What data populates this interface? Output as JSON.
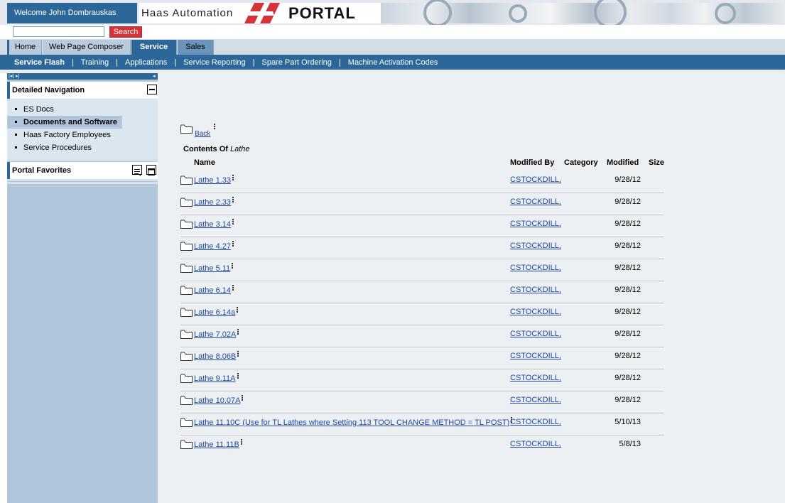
{
  "header": {
    "welcome": "Welcome John Dombrauskas",
    "brand": "Haas Automation",
    "portal": "PORTAL"
  },
  "search": {
    "value": "",
    "placeholder": "",
    "button_label": "Search"
  },
  "top_tabs": [
    {
      "label": "Home"
    },
    {
      "label": "Web Page Composer"
    },
    {
      "label": "Service"
    },
    {
      "label": "Sales"
    }
  ],
  "sub_nav": [
    {
      "label": "Service Flash"
    },
    {
      "label": "Training"
    },
    {
      "label": "Applications"
    },
    {
      "label": "Service Reporting"
    },
    {
      "label": "Spare Part Ordering"
    },
    {
      "label": "Machine Activation Codes"
    }
  ],
  "sidebar": {
    "detailed_navigation": "Detailed Navigation",
    "items": [
      {
        "label": "ES Docs"
      },
      {
        "label": "Documents and Software"
      },
      {
        "label": "Haas Factory Employees"
      },
      {
        "label": "Service Procedures"
      }
    ],
    "portal_favorites": "Portal Favorites"
  },
  "content": {
    "back_label": "Back",
    "contents_of_label": "Contents Of",
    "contents_of_name": "Lathe",
    "columns": {
      "name": "Name",
      "modified_by": "Modified By",
      "category": "Category",
      "modified": "Modified",
      "size": "Size"
    },
    "rows": [
      {
        "name": "Lathe 1.33",
        "modified_by": "CSTOCKDILL,",
        "modified": "9/28/12"
      },
      {
        "name": "Lathe 2.33",
        "modified_by": "CSTOCKDILL,",
        "modified": "9/28/12"
      },
      {
        "name": "Lathe 3.14",
        "modified_by": "CSTOCKDILL,",
        "modified": "9/28/12"
      },
      {
        "name": "Lathe 4.27",
        "modified_by": "CSTOCKDILL,",
        "modified": "9/28/12"
      },
      {
        "name": "Lathe 5.11",
        "modified_by": "CSTOCKDILL,",
        "modified": "9/28/12"
      },
      {
        "name": "Lathe 6.14",
        "modified_by": "CSTOCKDILL,",
        "modified": "9/28/12"
      },
      {
        "name": "Lathe 6.14a",
        "modified_by": "CSTOCKDILL,",
        "modified": "9/28/12"
      },
      {
        "name": "Lathe 7.02A",
        "modified_by": "CSTOCKDILL,",
        "modified": "9/28/12"
      },
      {
        "name": "Lathe 8.06B",
        "modified_by": "CSTOCKDILL,",
        "modified": "9/28/12"
      },
      {
        "name": "Lathe 9.11A",
        "modified_by": "CSTOCKDILL,",
        "modified": "9/28/12"
      },
      {
        "name": "Lathe 10.07A",
        "modified_by": "CSTOCKDILL,",
        "modified": "9/28/12"
      },
      {
        "name": "Lathe 11.10C (Use for TL Lathes where Setting 113 TOOL CHANGE METHOD = TL POST)",
        "modified_by": "CSTOCKDILL,",
        "modified": "5/10/13"
      },
      {
        "name": "Lathe 11.11B",
        "modified_by": "CSTOCKDILL,",
        "modified": "5/8/13"
      }
    ]
  },
  "colors": {
    "brand_blue": "#2d6799",
    "sidebar_blue": "#b2c6db",
    "search_red": "#d3343a",
    "link_blue": "#1c48a0"
  }
}
